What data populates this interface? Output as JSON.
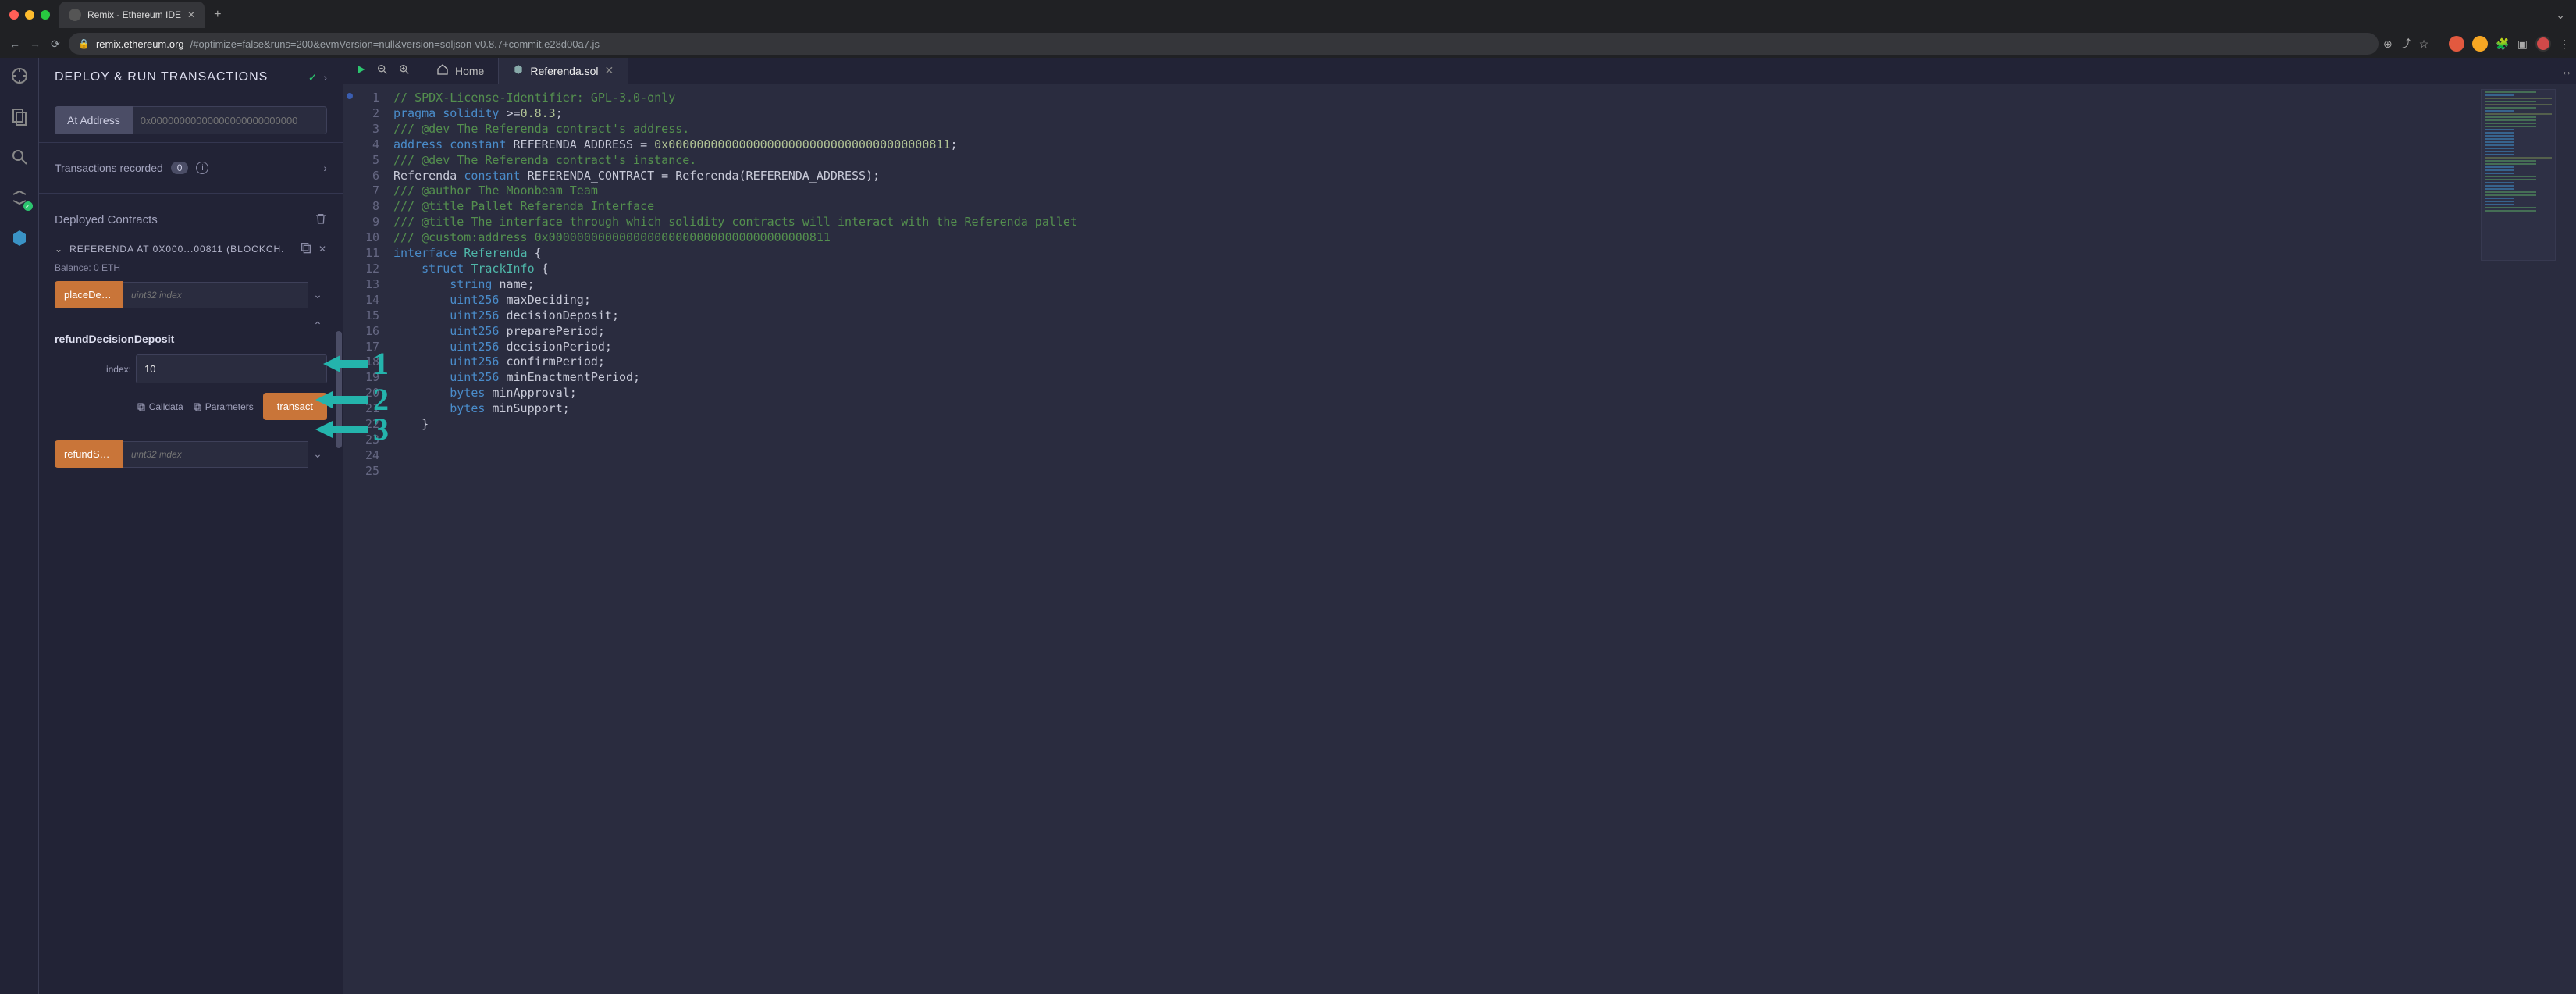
{
  "browser": {
    "tab_title": "Remix - Ethereum IDE",
    "url_domain": "remix.ethereum.org",
    "url_path": "/#optimize=false&runs=200&evmVersion=null&version=soljson-v0.8.7+commit.e28d00a7.js"
  },
  "panel": {
    "title": "DEPLOY & RUN TRANSACTIONS",
    "at_address_label": "At Address",
    "at_address_placeholder": "0x00000000000000000000000000",
    "tx_recorded_label": "Transactions recorded",
    "tx_recorded_count": "0",
    "deployed_title": "Deployed Contracts",
    "contract_name": "REFERENDA AT 0X000...00811 (BLOCKCH.",
    "balance_label": "Balance: 0 ETH",
    "fn1_label": "placeDecis...",
    "fn1_placeholder": "uint32 index",
    "expanded_fn_name": "refundDecisionDeposit",
    "param_label": "index:",
    "param_value": "10",
    "calldata_label": "Calldata",
    "parameters_label": "Parameters",
    "transact_label": "transact",
    "fn2_label": "refundSub...",
    "fn2_placeholder": "uint32 index"
  },
  "tabs": {
    "home": "Home",
    "file": "Referenda.sol"
  },
  "editor": {
    "lines": [
      {
        "n": 1,
        "segs": [
          {
            "c": "tok-comment",
            "t": "// SPDX-License-Identifier: GPL-3.0-only"
          }
        ]
      },
      {
        "n": 2,
        "segs": [
          {
            "c": "tok-keyword",
            "t": "pragma"
          },
          {
            "c": "",
            "t": " "
          },
          {
            "c": "tok-keyword",
            "t": "solidity"
          },
          {
            "c": "",
            "t": " >="
          },
          {
            "c": "tok-num",
            "t": "0.8.3"
          },
          {
            "c": "",
            "t": ";"
          }
        ]
      },
      {
        "n": 3,
        "segs": [
          {
            "c": "",
            "t": ""
          }
        ]
      },
      {
        "n": 4,
        "segs": [
          {
            "c": "tok-comment",
            "t": "/// @dev The Referenda contract's address."
          }
        ]
      },
      {
        "n": 5,
        "segs": [
          {
            "c": "tok-keyword",
            "t": "address"
          },
          {
            "c": "",
            "t": " "
          },
          {
            "c": "tok-const",
            "t": "constant"
          },
          {
            "c": "",
            "t": " REFERENDA_ADDRESS = "
          },
          {
            "c": "tok-num",
            "t": "0x0000000000000000000000000000000000000811"
          },
          {
            "c": "",
            "t": ";"
          }
        ]
      },
      {
        "n": 6,
        "segs": [
          {
            "c": "",
            "t": ""
          }
        ]
      },
      {
        "n": 7,
        "segs": [
          {
            "c": "tok-comment",
            "t": "/// @dev The Referenda contract's instance."
          }
        ]
      },
      {
        "n": 8,
        "segs": [
          {
            "c": "",
            "t": "Referenda "
          },
          {
            "c": "tok-const",
            "t": "constant"
          },
          {
            "c": "",
            "t": " REFERENDA_CONTRACT = Referenda(REFERENDA_ADDRESS);"
          }
        ]
      },
      {
        "n": 9,
        "segs": [
          {
            "c": "",
            "t": ""
          }
        ]
      },
      {
        "n": 10,
        "segs": [
          {
            "c": "tok-comment",
            "t": "/// @author The Moonbeam Team"
          }
        ]
      },
      {
        "n": 11,
        "segs": [
          {
            "c": "tok-comment",
            "t": "/// @title Pallet Referenda Interface"
          }
        ]
      },
      {
        "n": 12,
        "segs": [
          {
            "c": "tok-comment",
            "t": "/// @title The interface through which solidity contracts will interact with the Referenda pallet"
          }
        ]
      },
      {
        "n": 13,
        "segs": [
          {
            "c": "tok-comment",
            "t": "/// @custom:address 0x0000000000000000000000000000000000000811"
          }
        ]
      },
      {
        "n": 14,
        "segs": [
          {
            "c": "tok-keyword",
            "t": "interface"
          },
          {
            "c": "",
            "t": " "
          },
          {
            "c": "tok-type",
            "t": "Referenda"
          },
          {
            "c": "",
            "t": " {"
          }
        ]
      },
      {
        "n": 15,
        "segs": [
          {
            "c": "",
            "t": "    "
          },
          {
            "c": "tok-keyword",
            "t": "struct"
          },
          {
            "c": "",
            "t": " "
          },
          {
            "c": "tok-type",
            "t": "TrackInfo"
          },
          {
            "c": "",
            "t": " {"
          }
        ]
      },
      {
        "n": 16,
        "segs": [
          {
            "c": "",
            "t": "        "
          },
          {
            "c": "tok-keyword",
            "t": "string"
          },
          {
            "c": "",
            "t": " name;"
          }
        ]
      },
      {
        "n": 17,
        "segs": [
          {
            "c": "",
            "t": "        "
          },
          {
            "c": "tok-keyword",
            "t": "uint256"
          },
          {
            "c": "",
            "t": " maxDeciding;"
          }
        ]
      },
      {
        "n": 18,
        "segs": [
          {
            "c": "",
            "t": "        "
          },
          {
            "c": "tok-keyword",
            "t": "uint256"
          },
          {
            "c": "",
            "t": " decisionDeposit;"
          }
        ]
      },
      {
        "n": 19,
        "segs": [
          {
            "c": "",
            "t": "        "
          },
          {
            "c": "tok-keyword",
            "t": "uint256"
          },
          {
            "c": "",
            "t": " preparePeriod;"
          }
        ]
      },
      {
        "n": 20,
        "segs": [
          {
            "c": "",
            "t": "        "
          },
          {
            "c": "tok-keyword",
            "t": "uint256"
          },
          {
            "c": "",
            "t": " decisionPeriod;"
          }
        ]
      },
      {
        "n": 21,
        "segs": [
          {
            "c": "",
            "t": "        "
          },
          {
            "c": "tok-keyword",
            "t": "uint256"
          },
          {
            "c": "",
            "t": " confirmPeriod;"
          }
        ]
      },
      {
        "n": 22,
        "segs": [
          {
            "c": "",
            "t": "        "
          },
          {
            "c": "tok-keyword",
            "t": "uint256"
          },
          {
            "c": "",
            "t": " minEnactmentPeriod;"
          }
        ]
      },
      {
        "n": 23,
        "segs": [
          {
            "c": "",
            "t": "        "
          },
          {
            "c": "tok-keyword",
            "t": "bytes"
          },
          {
            "c": "",
            "t": " minApproval;"
          }
        ]
      },
      {
        "n": 24,
        "segs": [
          {
            "c": "",
            "t": "        "
          },
          {
            "c": "tok-keyword",
            "t": "bytes"
          },
          {
            "c": "",
            "t": " minSupport;"
          }
        ]
      },
      {
        "n": 25,
        "segs": [
          {
            "c": "",
            "t": "    }"
          }
        ]
      }
    ]
  },
  "annotations": [
    "1",
    "2",
    "3"
  ]
}
